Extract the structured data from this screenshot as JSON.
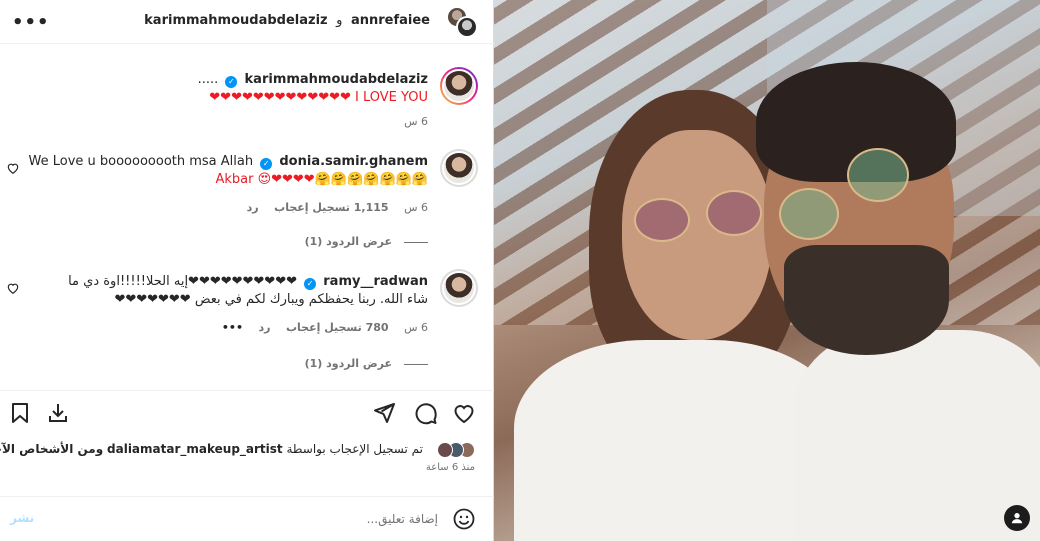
{
  "header": {
    "more": "•••",
    "user1": "karimmahmoudabdelaziz",
    "connector": "و",
    "user2": "annrefaiee"
  },
  "comments": [
    {
      "user": "karimmahmoudabdelaziz",
      "prefix": "..... ",
      "text": "I LOVE YOU ❤❤❤❤❤❤❤❤❤❤❤❤❤",
      "time": "6 س"
    },
    {
      "user": "donia.samir.ghanem",
      "text_line1": "We Love u booooooooth msa Allah",
      "text_line2": "Akbar 😍❤❤❤❤🤗🤗🤗🤗🤗🤗🤗",
      "time": "6 س",
      "likes": "1,115 تسجيل إعجاب",
      "reply": "رد",
      "view_replies": "عرض الردود (1)"
    },
    {
      "user": "ramy__radwan",
      "text_line1": "❤❤❤❤❤❤❤❤❤❤إيه الحلا!!!!!اوة دي ما",
      "text_line2": "شاء الله. ربنا يحفظكم ويبارك لكم في بعض ❤❤❤❤❤❤❤",
      "time": "6 س",
      "likes": "780 تسجيل إعجاب",
      "reply": "رد",
      "more": "•••",
      "view_replies": "عرض الردود (1)"
    }
  ],
  "likes": {
    "prefix": "تم تسجيل الإعجاب بواسطة",
    "user": "daliamatar_makeup_artist",
    "suffix": "ومن الأشخاص الآخرين"
  },
  "time_ago": "منذ 6 ساعة",
  "add_comment": {
    "placeholder": "إضافة تعليق...",
    "post": "نشر"
  }
}
